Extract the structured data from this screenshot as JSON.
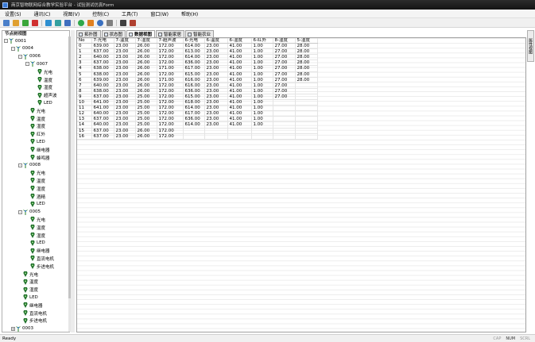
{
  "window": {
    "title": "商京智物联网综合教学实验平台 - 试验测试仿真Form"
  },
  "menu": [
    "设置(S)",
    "通讯(C)",
    "视图(V)",
    "控制(C)",
    "工具(T)",
    "窗口(W)",
    "帮助(H)"
  ],
  "toolbar": {
    "buttons": [
      {
        "icon": "new-icon",
        "color": "#4a7fc9"
      },
      {
        "icon": "edit-icon",
        "color": "#e0a030"
      },
      {
        "icon": "play-icon",
        "color": "#3aa63a"
      },
      {
        "icon": "stop-icon",
        "color": "#d03030"
      },
      {
        "icon": "network-icon",
        "color": "#2f8fd0"
      },
      {
        "icon": "connect-icon",
        "color": "#34a0a0"
      },
      {
        "icon": "download-icon",
        "color": "#3f6fbf"
      },
      {
        "icon": "help-icon",
        "color": "#2fa84a"
      },
      {
        "icon": "home-icon",
        "color": "#e08020"
      },
      {
        "icon": "users-icon",
        "color": "#3a70c0"
      },
      {
        "icon": "gear-icon",
        "color": "#808080"
      },
      {
        "icon": "monitor-icon",
        "color": "#404040"
      },
      {
        "icon": "book-icon",
        "color": "#b04030"
      }
    ]
  },
  "tree": {
    "title": "节点树视图",
    "nodes": [
      {
        "label": "0001",
        "level": 0,
        "kind": "node",
        "toggle": "-"
      },
      {
        "label": "0004",
        "level": 1,
        "kind": "node",
        "toggle": "-"
      },
      {
        "label": "0006",
        "level": 2,
        "kind": "node",
        "toggle": "-"
      },
      {
        "label": "0007",
        "level": 3,
        "kind": "node",
        "toggle": "-"
      },
      {
        "label": "光电",
        "level": 4,
        "kind": "sensor"
      },
      {
        "label": "温度",
        "level": 4,
        "kind": "sensor"
      },
      {
        "label": "湿度",
        "level": 4,
        "kind": "sensor"
      },
      {
        "label": "超声波",
        "level": 4,
        "kind": "sensor"
      },
      {
        "label": "LED",
        "level": 4,
        "kind": "sensor"
      },
      {
        "label": "光电",
        "level": 3,
        "kind": "sensor"
      },
      {
        "label": "温度",
        "level": 3,
        "kind": "sensor"
      },
      {
        "label": "湿度",
        "level": 3,
        "kind": "sensor"
      },
      {
        "label": "红外",
        "level": 3,
        "kind": "sensor"
      },
      {
        "label": "LED",
        "level": 3,
        "kind": "sensor"
      },
      {
        "label": "继电器",
        "level": 3,
        "kind": "sensor"
      },
      {
        "label": "蜂鸣器",
        "level": 3,
        "kind": "sensor"
      },
      {
        "label": "0008",
        "level": 2,
        "kind": "node",
        "toggle": "-"
      },
      {
        "label": "光电",
        "level": 3,
        "kind": "sensor"
      },
      {
        "label": "温度",
        "level": 3,
        "kind": "sensor"
      },
      {
        "label": "湿度",
        "level": 3,
        "kind": "sensor"
      },
      {
        "label": "酒精",
        "level": 3,
        "kind": "sensor"
      },
      {
        "label": "LED",
        "level": 3,
        "kind": "sensor"
      },
      {
        "label": "0005",
        "level": 2,
        "kind": "node",
        "toggle": "-"
      },
      {
        "label": "光电",
        "level": 3,
        "kind": "sensor"
      },
      {
        "label": "温度",
        "level": 3,
        "kind": "sensor"
      },
      {
        "label": "湿度",
        "level": 3,
        "kind": "sensor"
      },
      {
        "label": "LED",
        "level": 3,
        "kind": "sensor"
      },
      {
        "label": "继电器",
        "level": 3,
        "kind": "sensor"
      },
      {
        "label": "直流电机",
        "level": 3,
        "kind": "sensor"
      },
      {
        "label": "步进电机",
        "level": 3,
        "kind": "sensor"
      },
      {
        "label": "光电",
        "level": 2,
        "kind": "sensor"
      },
      {
        "label": "温度",
        "level": 2,
        "kind": "sensor"
      },
      {
        "label": "湿度",
        "level": 2,
        "kind": "sensor"
      },
      {
        "label": "LED",
        "level": 2,
        "kind": "sensor"
      },
      {
        "label": "继电器",
        "level": 2,
        "kind": "sensor"
      },
      {
        "label": "直流电机",
        "level": 2,
        "kind": "sensor"
      },
      {
        "label": "步进电机",
        "level": 2,
        "kind": "sensor"
      },
      {
        "label": "0003",
        "level": 1,
        "kind": "node",
        "toggle": "+"
      }
    ]
  },
  "tabs": [
    {
      "label": "拓扑图",
      "active": false
    },
    {
      "label": "状态图",
      "active": false
    },
    {
      "label": "数据视图",
      "active": true
    },
    {
      "label": "智能家居",
      "active": false
    },
    {
      "label": "智能农业",
      "active": false
    }
  ],
  "table": {
    "columns": [
      "No",
      "7-光电",
      "7-温度",
      "7-湿度",
      "7-超声波",
      "6-光电",
      "6-温度",
      "6-湿度",
      "6-红外",
      "8-湿度",
      "5-湿度"
    ],
    "rows": [
      [
        "0",
        "639.00",
        "23.00",
        "26.00",
        "172.00",
        "614.00",
        "23.00",
        "41.00",
        "1.00",
        "27.00",
        "28.00"
      ],
      [
        "1",
        "637.00",
        "23.00",
        "26.00",
        "172.00",
        "613.00",
        "23.00",
        "41.00",
        "1.00",
        "27.00",
        "28.00"
      ],
      [
        "2",
        "640.00",
        "23.00",
        "26.00",
        "172.00",
        "614.00",
        "23.00",
        "41.00",
        "1.00",
        "27.00",
        "28.00"
      ],
      [
        "3",
        "637.00",
        "23.00",
        "26.00",
        "172.00",
        "636.00",
        "23.00",
        "41.00",
        "1.00",
        "27.00",
        "28.00"
      ],
      [
        "4",
        "638.00",
        "23.00",
        "26.00",
        "171.00",
        "617.00",
        "23.00",
        "41.00",
        "1.00",
        "27.00",
        "28.00"
      ],
      [
        "5",
        "638.00",
        "23.00",
        "26.00",
        "172.00",
        "615.00",
        "23.00",
        "41.00",
        "1.00",
        "27.00",
        "28.00"
      ],
      [
        "6",
        "639.00",
        "23.00",
        "26.00",
        "171.00",
        "616.00",
        "23.00",
        "41.00",
        "1.00",
        "27.00",
        "28.00"
      ],
      [
        "7",
        "640.00",
        "23.00",
        "26.00",
        "172.00",
        "616.00",
        "23.00",
        "41.00",
        "1.00",
        "27.00",
        ""
      ],
      [
        "8",
        "638.00",
        "23.00",
        "26.00",
        "172.00",
        "636.00",
        "23.00",
        "41.00",
        "1.00",
        "27.00",
        ""
      ],
      [
        "9",
        "637.00",
        "23.00",
        "25.00",
        "172.00",
        "615.00",
        "23.00",
        "41.00",
        "1.00",
        "27.00",
        ""
      ],
      [
        "10",
        "641.00",
        "23.00",
        "25.00",
        "172.00",
        "618.00",
        "23.00",
        "41.00",
        "1.00",
        "",
        ""
      ],
      [
        "11",
        "641.00",
        "23.00",
        "25.00",
        "172.00",
        "614.00",
        "23.00",
        "41.00",
        "1.00",
        "",
        ""
      ],
      [
        "12",
        "640.00",
        "23.00",
        "25.00",
        "172.00",
        "617.00",
        "23.00",
        "41.00",
        "1.00",
        "",
        ""
      ],
      [
        "13",
        "637.00",
        "23.00",
        "25.00",
        "172.00",
        "636.00",
        "23.00",
        "41.00",
        "1.00",
        "",
        ""
      ],
      [
        "14",
        "640.00",
        "23.00",
        "25.00",
        "172.00",
        "614.00",
        "23.00",
        "41.00",
        "1.00",
        "",
        ""
      ],
      [
        "15",
        "637.00",
        "23.00",
        "26.00",
        "172.00",
        "",
        "",
        "",
        "",
        "",
        ""
      ],
      [
        "16",
        "637.00",
        "23.00",
        "26.00",
        "172.00",
        "",
        "",
        "",
        "",
        "",
        ""
      ]
    ]
  },
  "side_panel": {
    "label": "属性视图"
  },
  "status": {
    "ready": "Ready",
    "indicators": [
      {
        "label": "CAP",
        "on": false
      },
      {
        "label": "NUM",
        "on": true
      },
      {
        "label": "SCRL",
        "on": false
      }
    ]
  },
  "colors": {
    "node_icon": "#2a7f2a",
    "sensor_icon": "#1f6f2a",
    "accent": "#3a7bd5"
  }
}
